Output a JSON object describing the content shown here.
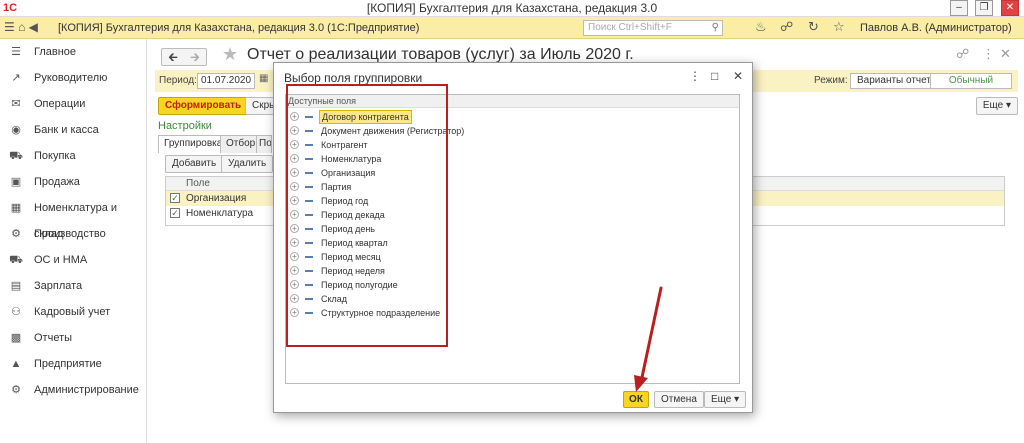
{
  "window": {
    "title": "[КОПИЯ] Бухгалтерия для Казахстана, редакция 3.0",
    "app_title": "[КОПИЯ] Бухгалтерия для Казахстана, редакция 3.0  (1С:Предприятие)",
    "logo": "1С"
  },
  "search": {
    "placeholder": "Поиск Ctrl+Shift+F"
  },
  "user": {
    "name": "Павлов А.В. (Администратор)"
  },
  "sidebar": {
    "items": [
      {
        "label": "Главное",
        "icon": "menu-icon"
      },
      {
        "label": "Руководителю",
        "icon": "chart-icon"
      },
      {
        "label": "Операции",
        "icon": "operations-icon"
      },
      {
        "label": "Банк и касса",
        "icon": "bank-icon"
      },
      {
        "label": "Покупка",
        "icon": "cart-icon"
      },
      {
        "label": "Продажа",
        "icon": "bag-icon"
      },
      {
        "label": "Номенклатура и склад",
        "icon": "warehouse-icon"
      },
      {
        "label": "Производство",
        "icon": "production-icon"
      },
      {
        "label": "ОС и НМА",
        "icon": "truck-icon"
      },
      {
        "label": "Зарплата",
        "icon": "salary-icon"
      },
      {
        "label": "Кадровый учет",
        "icon": "people-icon"
      },
      {
        "label": "Отчеты",
        "icon": "reports-icon"
      },
      {
        "label": "Предприятие",
        "icon": "enterprise-icon"
      },
      {
        "label": "Администрирование",
        "icon": "gear-icon"
      }
    ]
  },
  "form": {
    "title": "Отчет о реализации товаров (услуг)  за Июль 2020 г.",
    "period_label": "Период:",
    "period_value": "01.07.2020",
    "mode_label": "Режим:",
    "mode_variants": "Варианты отчетов",
    "mode_normal": "Обычный",
    "generate_button": "Сформировать",
    "hide_button": "Скры",
    "more_button": "Еще ▾",
    "settings_link": "Настройки",
    "tabs": [
      "Группировка",
      "Отбор",
      "По"
    ],
    "add_button": "Добавить",
    "delete_button": "Удалить",
    "grid": {
      "header": "Поле",
      "rows": [
        "Организация",
        "Номенклатура"
      ]
    }
  },
  "dialog": {
    "title": "Выбор поля группировки",
    "fields_header": "Доступные поля",
    "fields": [
      "Договор контрагента",
      "Документ движения (Регистратор)",
      "Контрагент",
      "Номенклатура",
      "Организация",
      "Партия",
      "Период год",
      "Период декада",
      "Период день",
      "Период квартал",
      "Период месяц",
      "Период неделя",
      "Период полугодие",
      "Склад",
      "Структурное подразделение"
    ],
    "ok_button": "ОК",
    "cancel_button": "Отмена",
    "more_button": "Еще ▾"
  }
}
